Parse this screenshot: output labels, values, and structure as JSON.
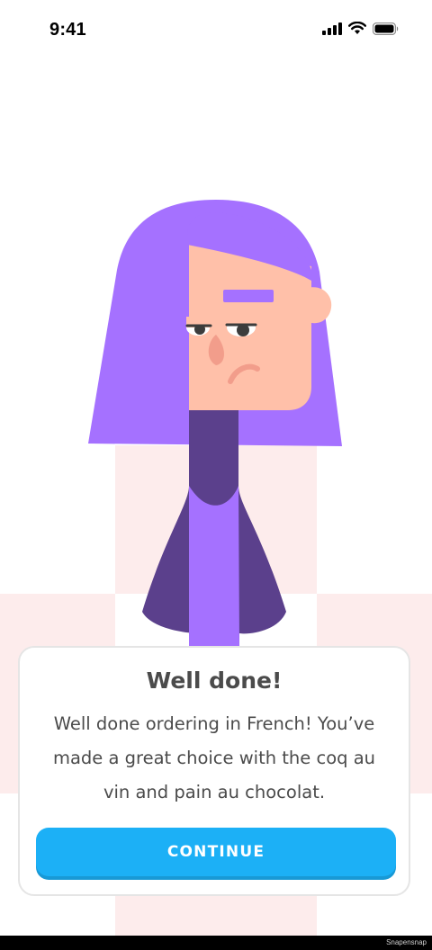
{
  "status_bar": {
    "time": "9:41"
  },
  "dialog": {
    "title": "Well done!",
    "message": "Well done ordering in French! You’ve made a great choice with the coq au vin and pain au chocolat.",
    "continue_label": "CONTINUE"
  },
  "watermark": "Snapensnap",
  "colors": {
    "accent": "#1cb0f6",
    "character_hair": "#a571ff",
    "character_shirt": "#5b408c",
    "floor_tint": "#fdecec"
  },
  "icons": [
    "cellular-signal-icon",
    "wifi-icon",
    "battery-icon"
  ]
}
